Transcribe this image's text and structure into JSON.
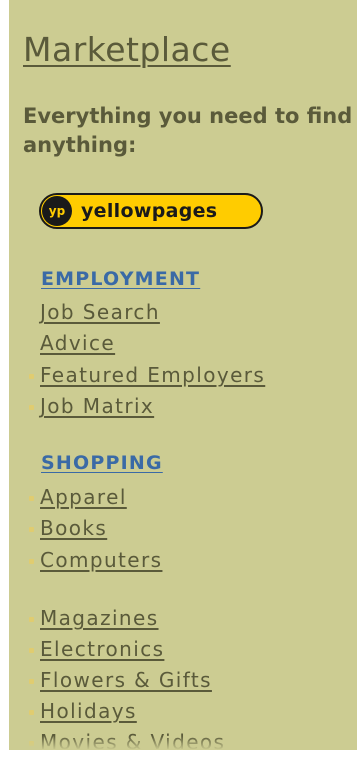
{
  "marketplace": {
    "title": "Marketplace",
    "tagline": "Everything you need to find anything:",
    "logo": {
      "badge": "yp",
      "text": "yellowpages"
    }
  },
  "employment": {
    "header": "EMPLOYMENT",
    "items": [
      {
        "label": "Job Search",
        "bullet": false
      },
      {
        "label": "Advice",
        "bullet": false
      },
      {
        "label": "Featured Employers",
        "bullet": true
      },
      {
        "label": "Job Matrix",
        "bullet": true
      }
    ]
  },
  "shopping": {
    "header": "SHOPPING",
    "items": [
      {
        "label": "Apparel"
      },
      {
        "label": "Books"
      },
      {
        "label": "Computers"
      },
      {
        "label": "Magazines"
      },
      {
        "label": "Electronics"
      },
      {
        "label": "Flowers & Gifts"
      },
      {
        "label": "Holidays"
      },
      {
        "label": "Movies & Videos"
      }
    ]
  },
  "colors": {
    "panel_background": "#cccc92",
    "text": "#5a5a3a",
    "section_header": "#3a6aa6",
    "logo_yellow": "#ffcc00",
    "bullet": "#e0cc70"
  }
}
